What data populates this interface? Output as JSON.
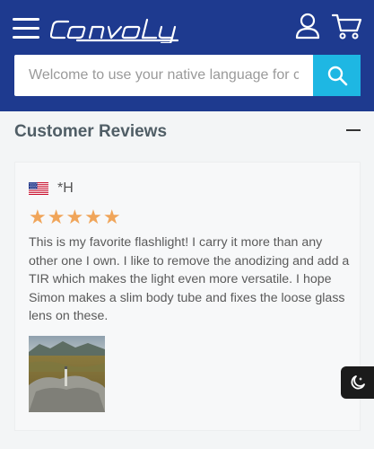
{
  "header": {
    "brand": "Convoy",
    "menu_icon": "hamburger-menu-icon",
    "account_icon": "user-icon",
    "cart_icon": "shopping-cart-icon",
    "background_color": "#1e3a8f"
  },
  "search": {
    "placeholder": "Welcome to use your native language for co...",
    "value": "",
    "button_icon": "search-icon",
    "button_color": "#1eb7e3"
  },
  "reviews_section": {
    "title": "Customer Reviews",
    "toggle_icon": "minus-icon",
    "reviews": [
      {
        "country_flag": "us-flag-icon",
        "reviewer": "*H",
        "rating": 5,
        "stars": "★★★★★",
        "text": "This is my favorite flashlight! I carry it more than any other one I own. I like to remove the anodizing and add a TIR which makes the light even more versatile. I hope Simon makes a slim body tube and fixes the loose glass lens on these.",
        "photo": "review-photo-landscape"
      }
    ]
  },
  "floating": {
    "theme_toggle_icon": "night-mode-icon"
  },
  "colors": {
    "star": "#f0a55a",
    "page_bg": "#f3f5f6"
  }
}
